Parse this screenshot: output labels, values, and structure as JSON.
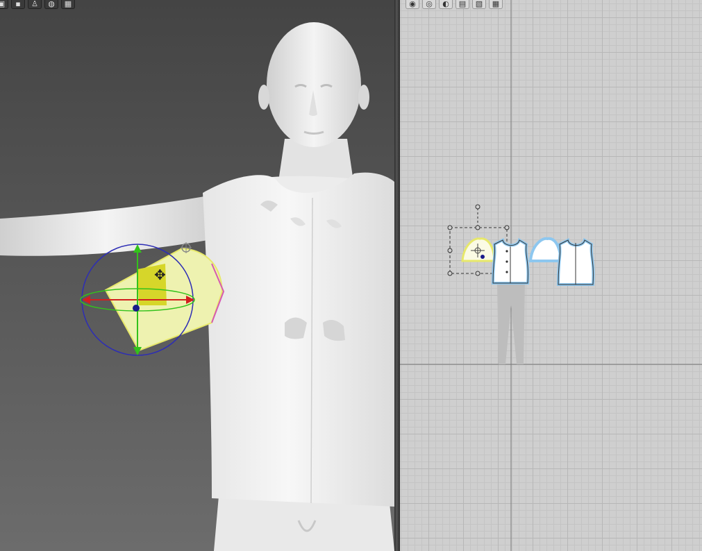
{
  "app": {
    "accent_selection": "#e7e86a",
    "gizmo_colors": {
      "x_axis": "#d21f1f",
      "y_axis": "#33c21b",
      "rotate_ring": "#2d2db5",
      "seam_glow": "#8dc7ef"
    }
  },
  "toolbar_3d": {
    "tools": [
      {
        "icon": "garment-display-icon",
        "glyph": "▣"
      },
      {
        "icon": "avatar-display-icon",
        "glyph": "▪"
      },
      {
        "icon": "avatar-pose-icon",
        "glyph": "♙"
      },
      {
        "icon": "texture-icon",
        "glyph": "◍"
      },
      {
        "icon": "grid-display-icon",
        "glyph": "▦"
      }
    ]
  },
  "toolbar_2d": {
    "tools": [
      {
        "icon": "eye-display-icon",
        "glyph": "◉"
      },
      {
        "icon": "eye-settings-icon",
        "glyph": "◎"
      },
      {
        "icon": "trace-icon",
        "glyph": "◐"
      },
      {
        "icon": "note-icon",
        "glyph": "▤"
      },
      {
        "icon": "layers-icon",
        "glyph": "▧"
      },
      {
        "icon": "grid-2d-icon",
        "glyph": "▦"
      }
    ]
  },
  "pattern_pieces": [
    {
      "name": "sleeve-piece-selected",
      "selected": true
    },
    {
      "name": "front-bodice-piece",
      "selected": false
    },
    {
      "name": "sleeve-piece-right",
      "selected": false
    },
    {
      "name": "back-bodice-piece",
      "selected": false
    }
  ]
}
